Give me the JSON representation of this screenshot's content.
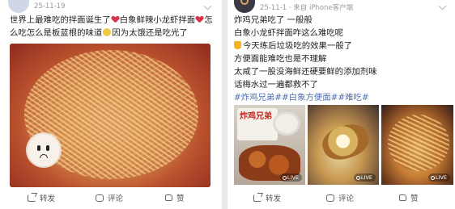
{
  "posts": [
    {
      "date": "25-11-19",
      "text_parts": {
        "p1": "世界上最难吃的拌面诞生了",
        "p2": "白象鲜辣小龙虾拌面",
        "p3": "怎么吃怎么是板蓝根的味道",
        "p4": "因为太饿还是吃光了"
      },
      "actions": {
        "share": "转发",
        "comment": "评论",
        "like": "赞"
      }
    },
    {
      "meta": "25-11-1 · 来自 iPhone客户端",
      "lines": {
        "l1": "炸鸡兄弟吃了 一般般",
        "l2": "白象小龙虾拌面咋这么难吃呢",
        "l3": "今天练后垃圾吃的效果一般了",
        "l4": "方便面能难吃也是不理解",
        "l5": "太咸了一股没海鲜还硬要鲜的添加剂味",
        "l6": "话梅水过一遍都救不了",
        "tags": "#炸鸡兄弟##白象方便面##难吃#"
      },
      "package_text": "炸鸡兄弟",
      "live_label": "LIVE",
      "actions": {
        "share": "转发",
        "comment": "评论",
        "like": "赞"
      }
    }
  ]
}
